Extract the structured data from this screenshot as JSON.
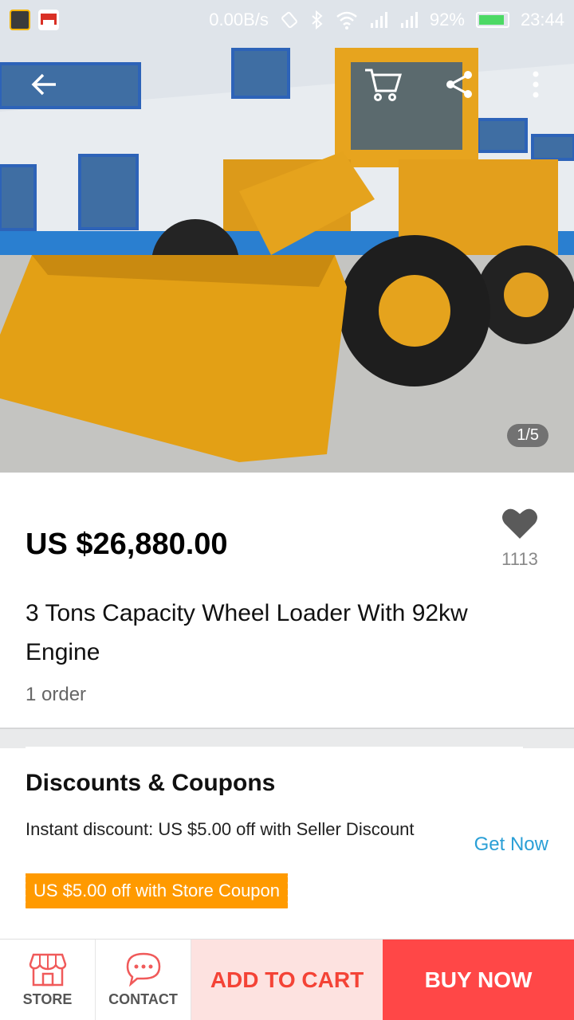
{
  "status_bar": {
    "net_speed": "0.00B/s",
    "battery": "92%",
    "battery_level": 0.92,
    "time": "23:44"
  },
  "gallery": {
    "page_indicator": "1/5"
  },
  "product": {
    "price": "US $26,880.00",
    "wishlist_count": "1113",
    "title": "3 Tons Capacity  Wheel Loader With 92kw Engine",
    "orders": "1 order"
  },
  "discounts": {
    "heading": "Discounts & Coupons",
    "instant_discount": "Instant discount: US $5.00 off with Seller Discount",
    "get_now": "Get Now",
    "store_coupon": "US $5.00 off with Store Coupon"
  },
  "bottom_bar": {
    "store_label": "STORE",
    "contact_label": "CONTACT",
    "add_to_cart_label": "ADD TO CART",
    "buy_now_label": "BUY NOW"
  },
  "colors": {
    "accent_red": "#ff4747",
    "cart_bg": "#fde2e0",
    "coupon_orange": "#ff9a00",
    "link_blue": "#2a9fd6"
  },
  "icons": [
    "back-arrow-icon",
    "cart-icon",
    "share-icon",
    "more-vert-icon",
    "heart-icon",
    "store-icon",
    "chat-icon"
  ]
}
